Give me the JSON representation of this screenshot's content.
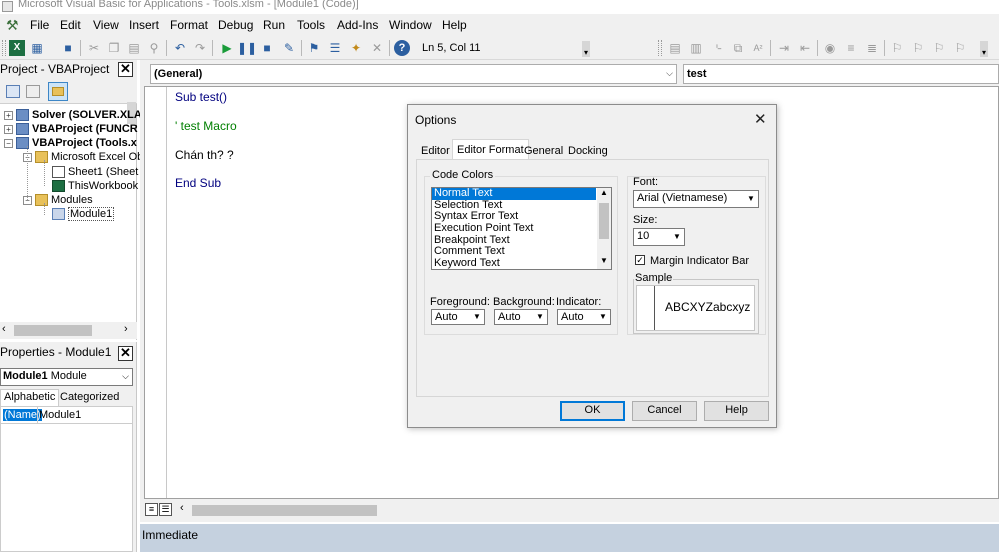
{
  "window": {
    "title": "Microsoft Visual Basic for Applications - Tools.xlsm - [Module1 (Code)]"
  },
  "menu": [
    "File",
    "Edit",
    "View",
    "Insert",
    "Format",
    "Debug",
    "Run",
    "Tools",
    "Add-Ins",
    "Window",
    "Help"
  ],
  "toolbar": {
    "position": "Ln 5, Col 11"
  },
  "project": {
    "title": "Project - VBAProject",
    "tree": [
      {
        "label": "Solver (SOLVER.XLA",
        "bold": true
      },
      {
        "label": "VBAProject (FUNCR",
        "bold": true
      },
      {
        "label": "VBAProject (Tools.x",
        "bold": true
      },
      {
        "label": "Microsoft Excel Ob",
        "bold": false
      },
      {
        "label": "Sheet1 (Sheet",
        "bold": false
      },
      {
        "label": "ThisWorkbook",
        "bold": false
      },
      {
        "label": "Modules",
        "bold": false
      },
      {
        "label": "Module1",
        "bold": false
      }
    ]
  },
  "properties": {
    "title": "Properties - Module1",
    "object_name": "Module1",
    "object_type": "Module",
    "tabs": [
      "Alphabetic",
      "Categorized"
    ],
    "row_name": "(Name)",
    "row_value": "Module1"
  },
  "code": {
    "object_combo": "(General)",
    "proc_combo": "test",
    "lines": [
      {
        "text": "Sub test()",
        "color": "#00007f"
      },
      {
        "text": "' test Macro",
        "color": "#007f00"
      },
      {
        "text": "Chán th? ?",
        "color": "#000000"
      },
      {
        "text": "End Sub",
        "color": "#00007f"
      }
    ]
  },
  "immediate": {
    "title": "Immediate"
  },
  "dialog": {
    "title": "Options",
    "tabs": [
      "Editor",
      "Editor Format",
      "General",
      "Docking"
    ],
    "code_colors_label": "Code Colors",
    "code_colors": [
      "Normal Text",
      "Selection Text",
      "Syntax Error Text",
      "Execution Point Text",
      "Breakpoint Text",
      "Comment Text",
      "Keyword Text"
    ],
    "foreground_label": "Foreground:",
    "background_label": "Background:",
    "indicator_label": "Indicator:",
    "foreground": "Auto",
    "background": "Auto",
    "indicator": "Auto",
    "font_label": "Font:",
    "font": "Arial (Vietnamese)",
    "size_label": "Size:",
    "size": "10",
    "margin_label": "Margin Indicator Bar",
    "sample_label": "Sample",
    "sample_text": "ABCXYZabcxyz",
    "ok": "OK",
    "cancel": "Cancel",
    "help": "Help"
  },
  "colors": {
    "selection": "#0078d7",
    "chrome": "#f0f0f0"
  }
}
